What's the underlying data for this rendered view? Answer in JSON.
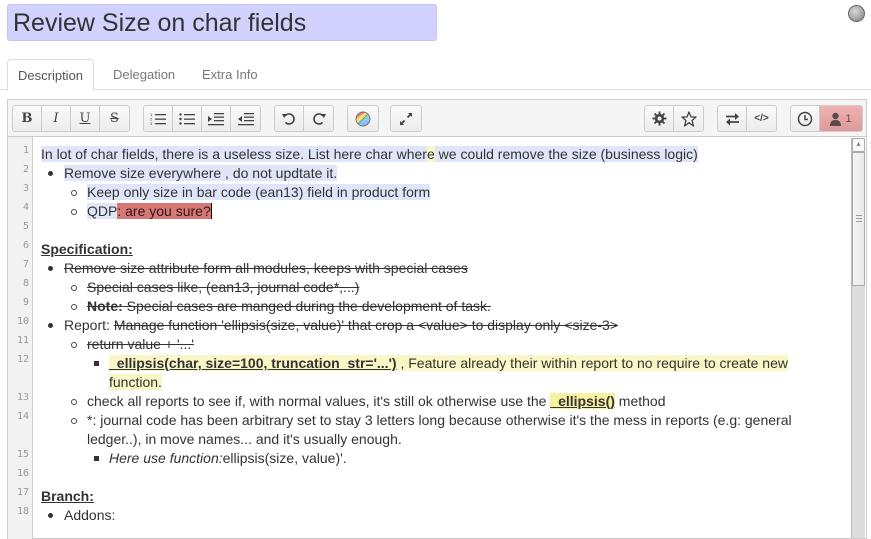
{
  "record": {
    "title": "Review Size on char fields",
    "status": "grey"
  },
  "tabs": [
    {
      "label": "Description",
      "active": true
    },
    {
      "label": "Delegation",
      "active": false
    },
    {
      "label": "Extra Info",
      "active": false
    }
  ],
  "toolbar": {
    "groups": [
      [
        "bold-icon",
        "italic-icon",
        "underline-icon",
        "strikethrough-icon"
      ],
      [
        "ordered-list-icon",
        "unordered-list-icon",
        "indent-icon",
        "outdent-icon"
      ],
      [
        "undo-icon",
        "redo-icon"
      ],
      [
        "color-icon"
      ],
      [
        "fullscreen-icon"
      ],
      [
        "settings-icon",
        "star-icon"
      ],
      [
        "swap-icon",
        "code-icon"
      ],
      [
        "history-icon",
        "user-icon"
      ]
    ],
    "bold_glyph": "B",
    "italic_glyph": "I",
    "underline_glyph": "U",
    "strike_glyph": "S",
    "code_glyph": "</>",
    "user_count": "1"
  },
  "editor": {
    "line_numbers": [
      "1",
      "2",
      "3",
      "4",
      "5",
      "6",
      "7",
      "8",
      "9",
      "10",
      "11",
      "12",
      "13",
      "14",
      "15",
      "16",
      "17",
      "18"
    ],
    "line1": {
      "a": "In lot of char fields, there is a useless size. List here char wher",
      "b": "e",
      "c": " we could remove the size (business logic)"
    },
    "line2": "Remove size everywhere , do not updtate it.",
    "line3": "Keep only size in bar code (ean13) field in product form",
    "line4": {
      "a": "QDP",
      "b": ": are you sure?"
    },
    "line6": "Specification: ",
    "line7": "Remove size attribute form all modules, keeps with special cases",
    "line8": "Special cases like, (ean13, journal code*,...)",
    "line9": {
      "bold": "Note:",
      "rest": " Special cases are manged during the development of task."
    },
    "line10": {
      "a": "Report: ",
      "b": "Manage function 'ellipsis(size, value)' that crop a <value> to display only <size-3>"
    },
    "line11": "return value + '...'",
    "line12": {
      "code": "_ellipsis(char, size=100, truncation_str='...')",
      "rest": " , Feature already their within report to no require to create new",
      "wrap": "function."
    },
    "line13": {
      "a": "check all reports to see if, with normal values, it's still ok otherwise use the ",
      "code": "_ellipsis()",
      "c": " method"
    },
    "line14": {
      "a": "*: journal code has been arbitrary set to stay 3 letters long because otherwise it's the mess in reports (e.g: general",
      "wrap": "ledger..), in move names... and it's usually enough."
    },
    "line15": {
      "italic": "Here use function:",
      "rest": "ellipsis(size, value)'."
    },
    "line17": "Branch:",
    "line18": "Addons:"
  }
}
